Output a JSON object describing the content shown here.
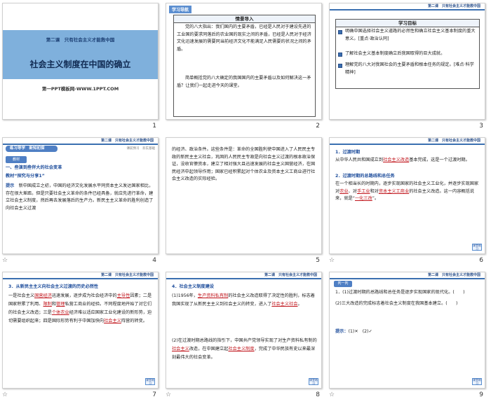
{
  "slides": {
    "s1": {
      "number": "1",
      "subtitle": "第二课　只有社会主义才能救中国",
      "title": "社会主义制度在中国的确立",
      "footer": "第一PPT模板网-WWW.1PPT.COM"
    },
    "s2": {
      "number": "2",
      "tab": "学习导航",
      "box_head": "情景导入",
      "p1": "党的八大指出：我们国内的主要矛盾，已经是人民对于建设先进的工业国的要求同落后的农业国的现实之间的矛盾，已经是人民对于经济文化迅速发展的需要同当前经济文化不能满足人民需要的状况之间的矛盾。",
      "p2": "简单概括党的八大确定的我国国内的主要矛盾以及如何解决这一矛盾？让我们一起走进今天的课堂。"
    },
    "s3": {
      "number": "3",
      "chapter": "第二课　只有社会主义才能救中国",
      "box_head": "学习目标",
      "goals": [
        "明确中国选择社会主义道路的必然性和确立社会主义基本制度的重大意义。[重点·政治认同]",
        "了解社会主义基本制度确立后我国取得的巨大成就。",
        "理解党的八大对我国社会的主要矛盾和根本任务的规定。[难点·科学精神]"
      ]
    },
    "s4": {
      "number": "4",
      "chapter": "第二课　只有社会主义才能救中国",
      "pill": "练习导学　新知初探",
      "subline": "课前预习　夯实基础",
      "tag": "教材",
      "heading": "一、叁演到叁伴大的社会变革",
      "link": "教材“探究与分享1”",
      "hint_label": "提示",
      "hint": "新中国成立之初，中国的经济文化发展水平同资本主义发达国家相比，存在很大差距。但是只要社会主义革命的条件已经具备，就应先进行革命，建立社会主义制度，然后再去发展落后的生产力。新民主主义革命的胜利创造了向社会主义过渡"
    },
    "s5": {
      "number": "5",
      "body": "的经济、政治条件。这些条件是：革命的全国胜利使中国进入了人民民主专政的新民主主义社会，巩固的人民民主专政是向社会主义过渡的根本政治保证，没收官僚资本，建立了相对强大且迅速发展的社会主义国营经济，在国民经济中起领导作用；国家已经积累起对个体农业及资本主义工商业进行社会主义改造的实际经验。"
    },
    "s6": {
      "number": "6",
      "chapter": "第二课　只有社会主义才能救中国",
      "h1": "1．过渡时期",
      "t1a": "从中华人民共和国成立到",
      "blank1": "社会主义改造",
      "t1b": "基本完成，这是一个过渡时期。",
      "h2": "2．过渡时期的总路线和总任务",
      "t2a": "在一个相当长的时期内，逐步实现国家的社会主义工业化，并逐步实现国家对",
      "blank2": "农业",
      "t2b": "、对",
      "blank3": "手工业",
      "t2c": "和对",
      "blank4": "资本主义工商业",
      "t2d": "的社会主义改造。这一内容概括说来，就是“",
      "blank5": "一化三改",
      "t2e": "”。",
      "back": "课堂练习"
    },
    "s7": {
      "number": "7",
      "chapter": "第二课　只有社会主义才能救中国",
      "h1": "3．从新民主主义向社会主义过渡的历史必然性",
      "t1": "一是社会主义",
      "b1": "国营经济",
      "t2": "迅速发展，逐步成为社会经济中的",
      "b2": "主导性",
      "t3": "因素；二是国家积累了利用、",
      "b3": "限制",
      "t4": "和",
      "b4": "管理",
      "t5": "私营工商业的经验。不同程度地开始了对它们的社会主义改造；三是",
      "b5": "个体农业",
      "t6": "经济难以适应国家工业化建设的新形势，迫切需要组织起来；四是国际形势有利于中国加快向",
      "b6": "社会主义",
      "t7": "阵营的转变。",
      "back": "课堂练习"
    },
    "s8": {
      "number": "8",
      "chapter": "第二课　只有社会主义才能救中国",
      "h1": "4．社会主义制度建设",
      "t1": "(1)1956年，",
      "b1": "生产资料私有制",
      "t2": "的社会主义改造取得了决定性的胜利，标志着我国实现了从新民主主义到社会主义的转变，进入了",
      "b2": "社会主义社会",
      "t3": "。",
      "t4": "(2)在过渡时期总路线的指引下，中国共产党领导实现了对生产资料私有制的",
      "b3": "社会主义",
      "t5": "改造，在中国建立起",
      "b4": "社会主义制度",
      "t6": "，完成了中华民族有史以来最深刻最伟大的社会变革。",
      "back": "课堂练习"
    },
    "s9": {
      "number": "9",
      "chapter": "第二课　只有社会主义才能救中国",
      "tag": "判一判",
      "q1": "1．(1)过渡时期的总路线和总任务是逐步实现国家的现代化。(　　)",
      "q2": "(2)三大改造的完成标志着社会主义制度在我国基本建立。(　　)",
      "ans_label": "提示：",
      "ans": "(1)✕　(2)✓",
      "back": "课堂练习"
    }
  },
  "star": "☆",
  "colors": {
    "accent": "#3a6fb0",
    "fill": "#c0141b",
    "band": "#7fb0dc"
  }
}
